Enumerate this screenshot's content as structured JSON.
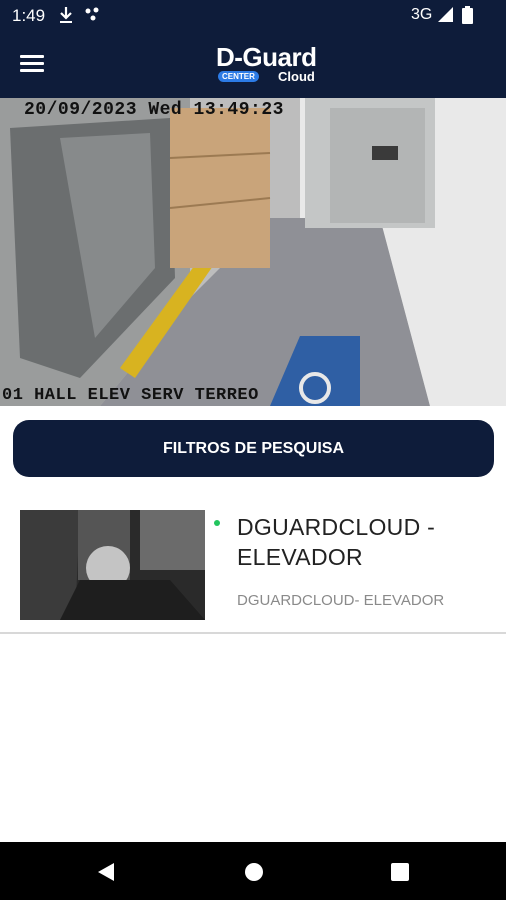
{
  "status_bar": {
    "time": "1:49",
    "network": "3G",
    "icons": [
      "download-icon",
      "notification-dots-icon",
      "signal-icon",
      "battery-icon"
    ]
  },
  "app_bar": {
    "logo_main": "D-Guard",
    "logo_center": "CENTER",
    "logo_cloud": "Cloud",
    "menu_icon": "hamburger-menu-icon"
  },
  "camera": {
    "osd_datetime": "20/09/2023 Wed 13:49:23",
    "osd_label": "01 HALL ELEV SERV TERREO"
  },
  "filter_button": {
    "label": "FILTROS DE PESQUISA"
  },
  "list": {
    "items": [
      {
        "title": "DGUARDCLOUD - ELEVADOR",
        "subtitle": "DGUARDCLOUD- ELEVADOR",
        "status": "online",
        "status_color": "#22c55e"
      }
    ]
  },
  "nav_bar": {
    "buttons": [
      "back-icon",
      "home-icon",
      "recents-icon"
    ]
  },
  "colors": {
    "primary": "#0e1c3a",
    "accent": "#2c7be5"
  }
}
